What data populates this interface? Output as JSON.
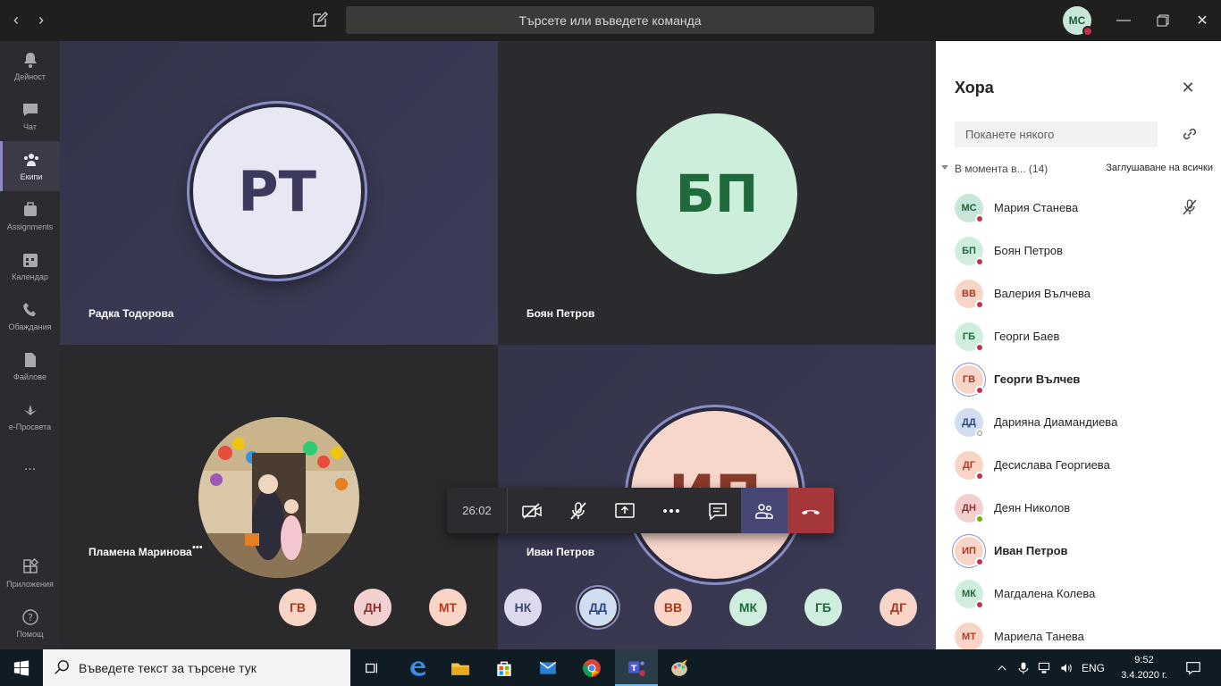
{
  "titlebar": {
    "search_placeholder": "Търсете или въведете команда",
    "user_initials": "МС"
  },
  "rail": [
    {
      "label": "Дейност",
      "icon": "bell-icon"
    },
    {
      "label": "Чат",
      "icon": "chat-icon"
    },
    {
      "label": "Екипи",
      "icon": "teams-icon",
      "active": true
    },
    {
      "label": "Assignments",
      "icon": "assignments-icon"
    },
    {
      "label": "Календар",
      "icon": "calendar-icon"
    },
    {
      "label": "Обаждания",
      "icon": "phone-icon"
    },
    {
      "label": "Файлове",
      "icon": "file-icon"
    },
    {
      "label": "e-Просвета",
      "icon": "eprosveta-icon"
    },
    {
      "label": "...",
      "icon": "more-icon"
    },
    {
      "label": "Приложения",
      "icon": "apps-icon"
    },
    {
      "label": "Помощ",
      "icon": "help-icon"
    }
  ],
  "stage": {
    "tiles": [
      {
        "name": "Радка Тодорова",
        "initials": "РТ"
      },
      {
        "name": "Боян Петров",
        "initials": "БП"
      },
      {
        "name": "Пламена Маринова",
        "initials": ""
      },
      {
        "name": "Иван Петров",
        "initials": "ИП"
      }
    ],
    "more_dots": "•••"
  },
  "controls": {
    "timer": "26:02"
  },
  "strip": [
    "ГВ",
    "ДН",
    "МТ",
    "НК",
    "ДД",
    "ВВ",
    "МК",
    "ГБ",
    "ДГ"
  ],
  "people": {
    "title": "Хора",
    "invite_placeholder": "Поканете някого",
    "section_label": "В момента в... (14)",
    "mute_all": "Заглушаване на всички",
    "list": [
      {
        "initials": "МС",
        "name": "Мария Станева"
      },
      {
        "initials": "БП",
        "name": "Боян Петров"
      },
      {
        "initials": "ВВ",
        "name": "Валерия Вълчева"
      },
      {
        "initials": "ГБ",
        "name": "Георги Баев"
      },
      {
        "initials": "ГВ",
        "name": "Георги Вълчев"
      },
      {
        "initials": "ДД",
        "name": "Дарияна Диамандиева"
      },
      {
        "initials": "ДГ",
        "name": "Десислава Георгиева"
      },
      {
        "initials": "ДН",
        "name": "Деян Николов"
      },
      {
        "initials": "ИП",
        "name": "Иван Петров"
      },
      {
        "initials": "МК",
        "name": "Магдалена Колева"
      },
      {
        "initials": "МТ",
        "name": "Мариела Танева"
      }
    ]
  },
  "taskbar": {
    "search_placeholder": "Въведете текст за търсене тук",
    "lang": "ENG",
    "time": "9:52",
    "date": "3.4.2020 г."
  },
  "colors": {
    "accent": "#8b8cc7",
    "hangup": "#a4373a",
    "busy": "#c4314b"
  }
}
